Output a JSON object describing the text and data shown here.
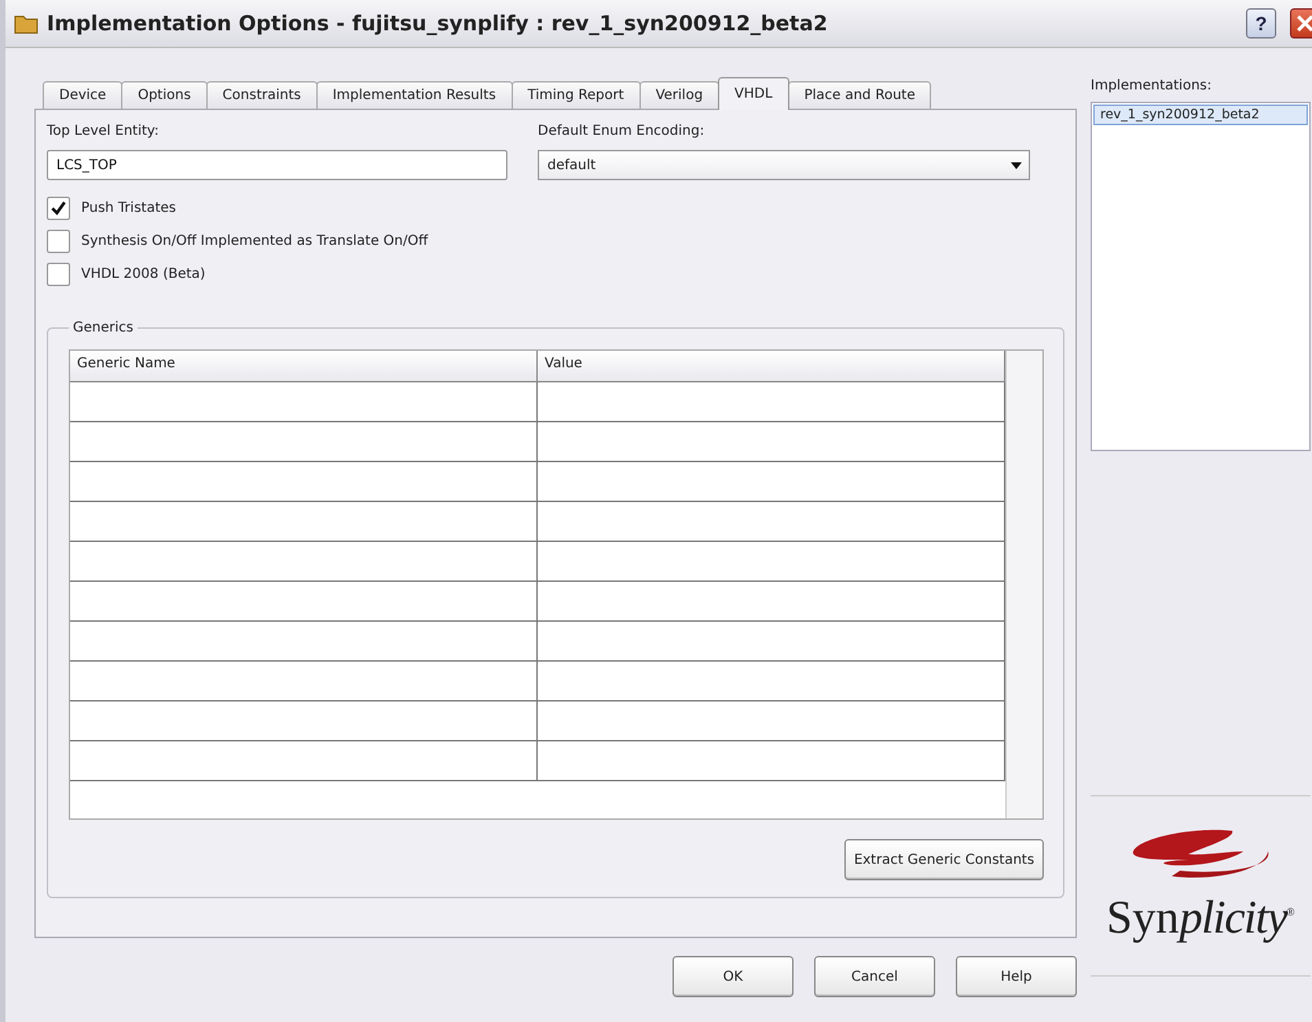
{
  "window": {
    "title": "Implementation Options  -  fujitsu_synplify : rev_1_syn200912_beta2",
    "help_button": "?"
  },
  "tabs": [
    {
      "label": "Device",
      "selected": false
    },
    {
      "label": "Options",
      "selected": false
    },
    {
      "label": "Constraints",
      "selected": false
    },
    {
      "label": "Implementation Results",
      "selected": false
    },
    {
      "label": "Timing Report",
      "selected": false
    },
    {
      "label": "Verilog",
      "selected": false
    },
    {
      "label": "VHDL",
      "selected": true
    },
    {
      "label": "Place and Route",
      "selected": false
    }
  ],
  "top_level_entity": {
    "label": "Top Level Entity:",
    "value": "LCS_TOP"
  },
  "default_enum_encoding": {
    "label": "Default Enum Encoding:",
    "value": "default"
  },
  "checkboxes": [
    {
      "label": "Push Tristates",
      "checked": true
    },
    {
      "label": "Synthesis On/Off Implemented as Translate On/Off",
      "checked": false
    },
    {
      "label": "VHDL 2008 (Beta)",
      "checked": false
    }
  ],
  "generics": {
    "title": "Generics",
    "columns": [
      "Generic Name",
      "Value"
    ],
    "extract_button": "Extract Generic Constants"
  },
  "implementations": {
    "label": "Implementations:",
    "items": [
      {
        "label": "rev_1_syn200912_beta2",
        "selected": true
      }
    ]
  },
  "logo": {
    "plain": "Syn",
    "italic": "plicity",
    "mark": "®"
  },
  "buttons": [
    "OK",
    "Cancel",
    "Help"
  ]
}
